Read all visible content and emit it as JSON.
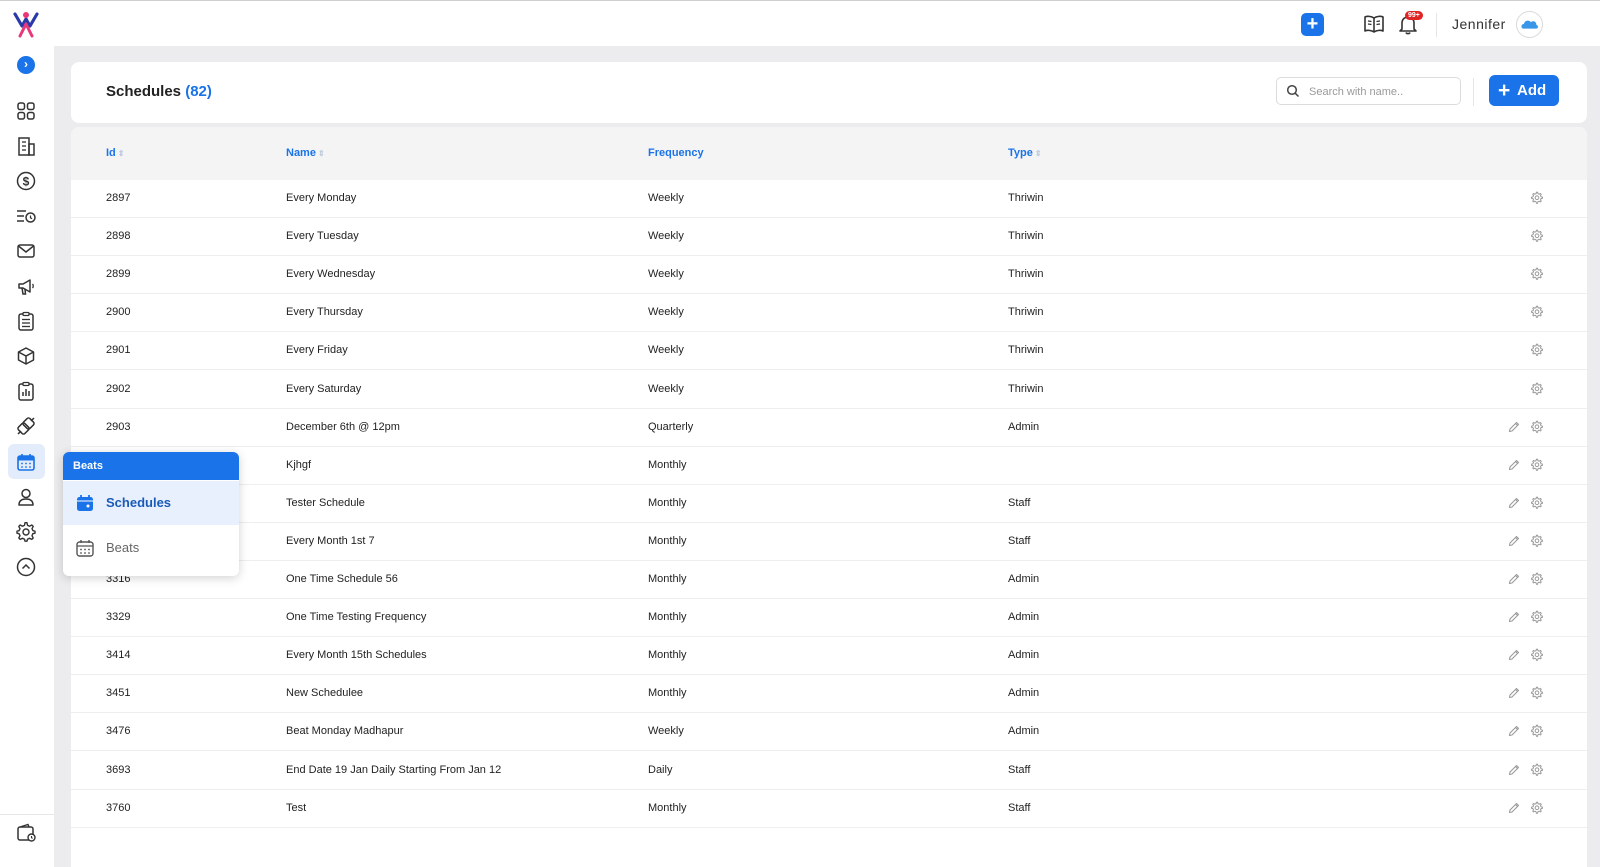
{
  "topbar": {
    "add_label": "+",
    "notification_badge": "99+",
    "user_name": "Jennifer"
  },
  "sidebar": {
    "toggle_label": "›",
    "items": [
      {
        "name": "dashboard",
        "icon": "grid-icon"
      },
      {
        "name": "organization",
        "icon": "building-icon"
      },
      {
        "name": "finance",
        "icon": "dollar-icon"
      },
      {
        "name": "tasks",
        "icon": "list-clock-icon"
      },
      {
        "name": "messages",
        "icon": "mail-icon"
      },
      {
        "name": "campaigns",
        "icon": "megaphone-icon"
      },
      {
        "name": "reports",
        "icon": "clipboard-list-icon"
      },
      {
        "name": "products",
        "icon": "cube-icon"
      },
      {
        "name": "analytics",
        "icon": "clipboard-chart-icon"
      },
      {
        "name": "integrations",
        "icon": "plug-icon"
      },
      {
        "name": "schedules",
        "icon": "calendar-icon",
        "active": true
      },
      {
        "name": "users",
        "icon": "user-icon"
      },
      {
        "name": "settings",
        "icon": "gear-icon"
      },
      {
        "name": "collapse",
        "icon": "chevron-up-circle-icon"
      }
    ]
  },
  "header": {
    "title": "Schedules",
    "count": "(82)",
    "search_placeholder": "Search with name..",
    "add_label": "Add"
  },
  "table": {
    "columns": {
      "id": "Id",
      "name": "Name",
      "frequency": "Frequency",
      "type": "Type"
    },
    "rows": [
      {
        "id": "2897",
        "name": "Every Monday",
        "frequency": "Weekly",
        "type": "Thriwin",
        "editable": false
      },
      {
        "id": "2898",
        "name": "Every Tuesday",
        "frequency": "Weekly",
        "type": "Thriwin",
        "editable": false
      },
      {
        "id": "2899",
        "name": "Every Wednesday",
        "frequency": "Weekly",
        "type": "Thriwin",
        "editable": false
      },
      {
        "id": "2900",
        "name": "Every Thursday",
        "frequency": "Weekly",
        "type": "Thriwin",
        "editable": false
      },
      {
        "id": "2901",
        "name": "Every Friday",
        "frequency": "Weekly",
        "type": "Thriwin",
        "editable": false
      },
      {
        "id": "2902",
        "name": "Every Saturday",
        "frequency": "Weekly",
        "type": "Thriwin",
        "editable": false
      },
      {
        "id": "2903",
        "name": "December 6th @ 12pm",
        "frequency": "Quarterly",
        "type": "Admin",
        "editable": true
      },
      {
        "id": "",
        "name": "Kjhgf",
        "frequency": "Monthly",
        "type": "",
        "editable": true
      },
      {
        "id": "",
        "name": "Tester Schedule",
        "frequency": "Monthly",
        "type": "Staff",
        "editable": true
      },
      {
        "id": "",
        "name": "Every Month 1st 7",
        "frequency": "Monthly",
        "type": "Staff",
        "editable": true
      },
      {
        "id": "3316",
        "name": "One Time Schedule 56",
        "frequency": "Monthly",
        "type": "Admin",
        "editable": true
      },
      {
        "id": "3329",
        "name": "One Time Testing Frequency",
        "frequency": "Monthly",
        "type": "Admin",
        "editable": true
      },
      {
        "id": "3414",
        "name": "Every Month 15th Schedules",
        "frequency": "Monthly",
        "type": "Admin",
        "editable": true
      },
      {
        "id": "3451",
        "name": "New Scheduleе",
        "frequency": "Monthly",
        "type": "Admin",
        "editable": true
      },
      {
        "id": "3476",
        "name": "Beat Monday Madhapur",
        "frequency": "Weekly",
        "type": "Admin",
        "editable": true
      },
      {
        "id": "3693",
        "name": "End Date 19 Jan Daily Starting From Jan 12",
        "frequency": "Daily",
        "type": "Staff",
        "editable": true
      },
      {
        "id": "3760",
        "name": "Test",
        "frequency": "Monthly",
        "type": "Staff",
        "editable": true
      }
    ]
  },
  "popover": {
    "header": "Beats",
    "items": [
      {
        "label": "Schedules",
        "icon": "calendar-filled-icon",
        "active": true
      },
      {
        "label": "Beats",
        "icon": "calendar-grid-icon",
        "active": false
      }
    ]
  },
  "colors": {
    "accent": "#1a73e8",
    "badge": "#e02424",
    "background": "#ececee"
  }
}
